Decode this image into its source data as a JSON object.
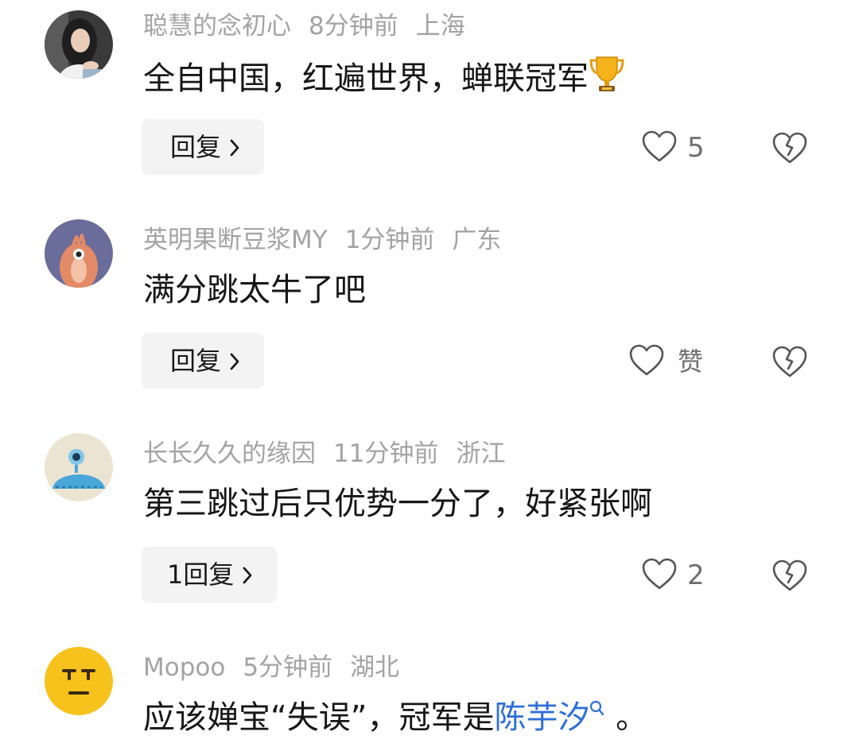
{
  "comments": [
    {
      "username": "聪慧的念初心",
      "time": "8分钟前",
      "location": "上海",
      "text": "全自中国，红遍世界，蝉联冠军",
      "emoji_icon": "trophy-icon",
      "reply_label": "回复",
      "like_count": "5"
    },
    {
      "username": "英明果断豆浆MY",
      "time": "1分钟前",
      "location": "广东",
      "text": "满分跳太牛了吧",
      "reply_label": "回复",
      "like_count": "赞"
    },
    {
      "username": "长长久久的缘因",
      "time": "11分钟前",
      "location": "浙江",
      "text": "第三跳过后只优势一分了，好紧张啊",
      "reply_label": "1回复",
      "like_count": "2"
    },
    {
      "username": "Mopoo",
      "time": "5分钟前",
      "location": "湖北",
      "text_before": "应该婵宝“失误”，冠军是",
      "text_link": "陈芋汐",
      "text_after": " 。"
    }
  ],
  "colors": {
    "meta_gray": "#a3a3a3",
    "link_blue": "#2f6fd6",
    "button_bg": "#f3f3f3",
    "icon_gray": "#555555"
  }
}
